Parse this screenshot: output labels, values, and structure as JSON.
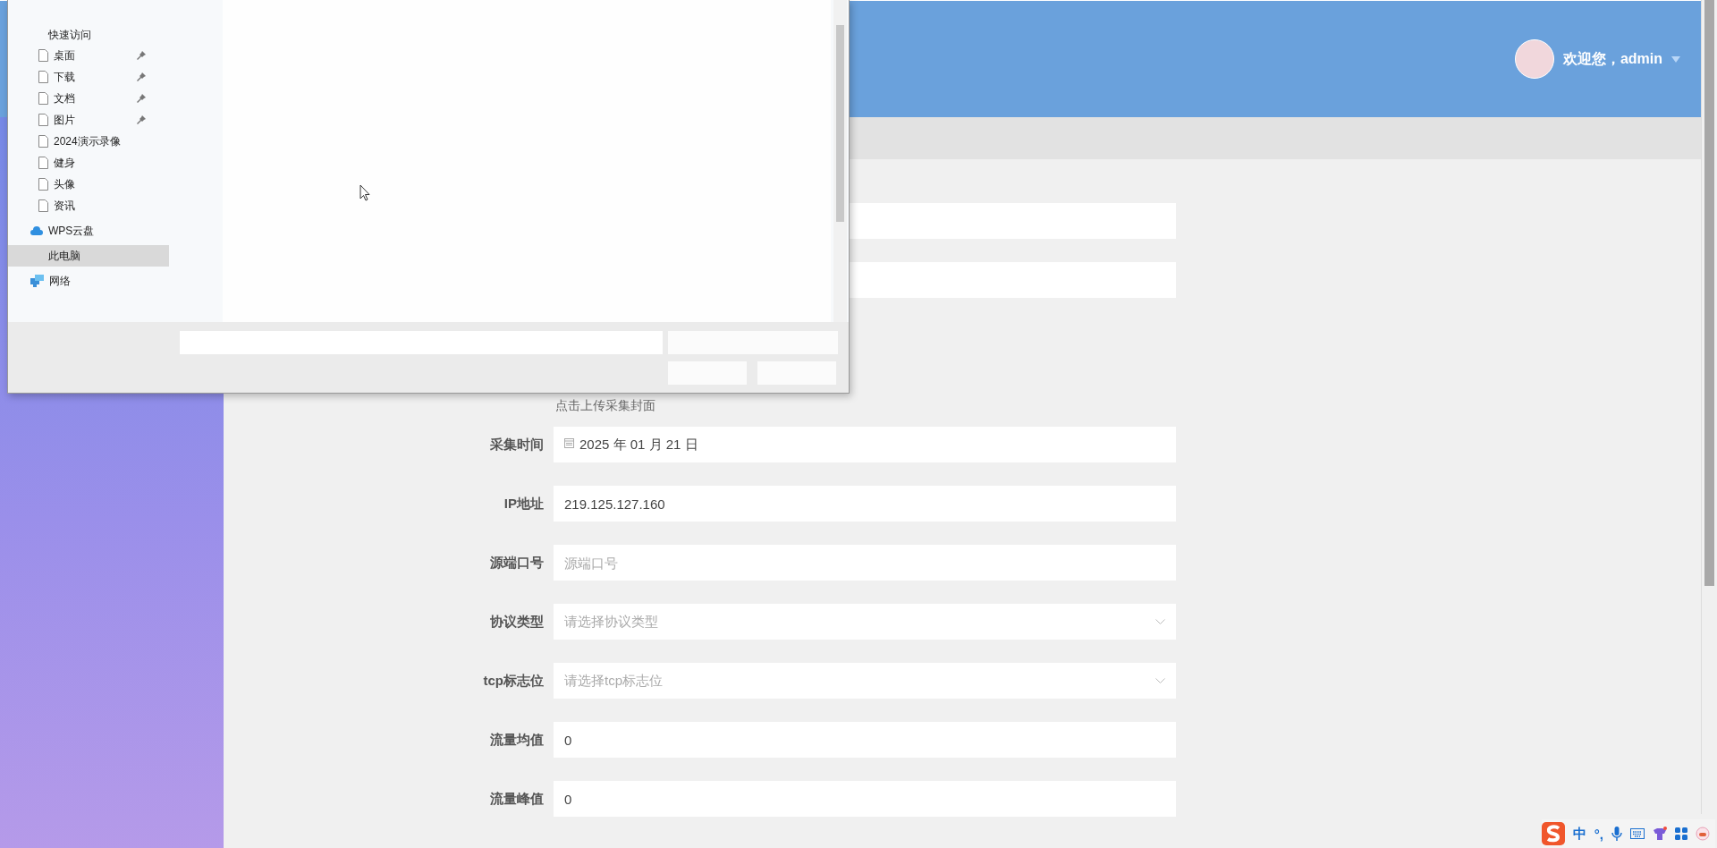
{
  "header": {
    "greeting": "欢迎您，admin"
  },
  "form": {
    "hint": "点击上传采集封面",
    "fields": [
      {
        "kind": "date",
        "label": "采集时间",
        "value": "2025 年 01 月 21 日"
      },
      {
        "kind": "text",
        "label": "IP地址",
        "value": "219.125.127.160"
      },
      {
        "kind": "text",
        "label": "源端口号",
        "placeholder": "源端口号"
      },
      {
        "kind": "select",
        "label": "协议类型",
        "placeholder": "请选择协议类型"
      },
      {
        "kind": "select",
        "label": "tcp标志位",
        "placeholder": "请选择tcp标志位"
      },
      {
        "kind": "text",
        "label": "流量均值",
        "value": "0"
      },
      {
        "kind": "text",
        "label": "流量峰值",
        "value": "0"
      }
    ]
  },
  "file_dialog": {
    "nav": [
      {
        "kind": "heading",
        "label": "快速访问"
      },
      {
        "kind": "folder",
        "label": "桌面",
        "pinned": true,
        "selected": false
      },
      {
        "kind": "folder",
        "label": "下载",
        "pinned": true,
        "selected": false
      },
      {
        "kind": "folder",
        "label": "文档",
        "pinned": true,
        "selected": false
      },
      {
        "kind": "folder",
        "label": "图片",
        "pinned": true,
        "selected": false
      },
      {
        "kind": "folder",
        "label": "2024演示录像",
        "pinned": false,
        "selected": false
      },
      {
        "kind": "folder",
        "label": "健身",
        "pinned": false,
        "selected": false
      },
      {
        "kind": "folder",
        "label": "头像",
        "pinned": false,
        "selected": false
      },
      {
        "kind": "folder",
        "label": "资讯",
        "pinned": false,
        "selected": false
      },
      {
        "kind": "cloud",
        "label": "WPS云盘",
        "selected": false
      },
      {
        "kind": "computer",
        "label": "此电脑",
        "selected": true
      },
      {
        "kind": "network",
        "label": "网络",
        "selected": false
      }
    ]
  },
  "tray": {
    "mode": "中",
    "punct": "°,"
  }
}
